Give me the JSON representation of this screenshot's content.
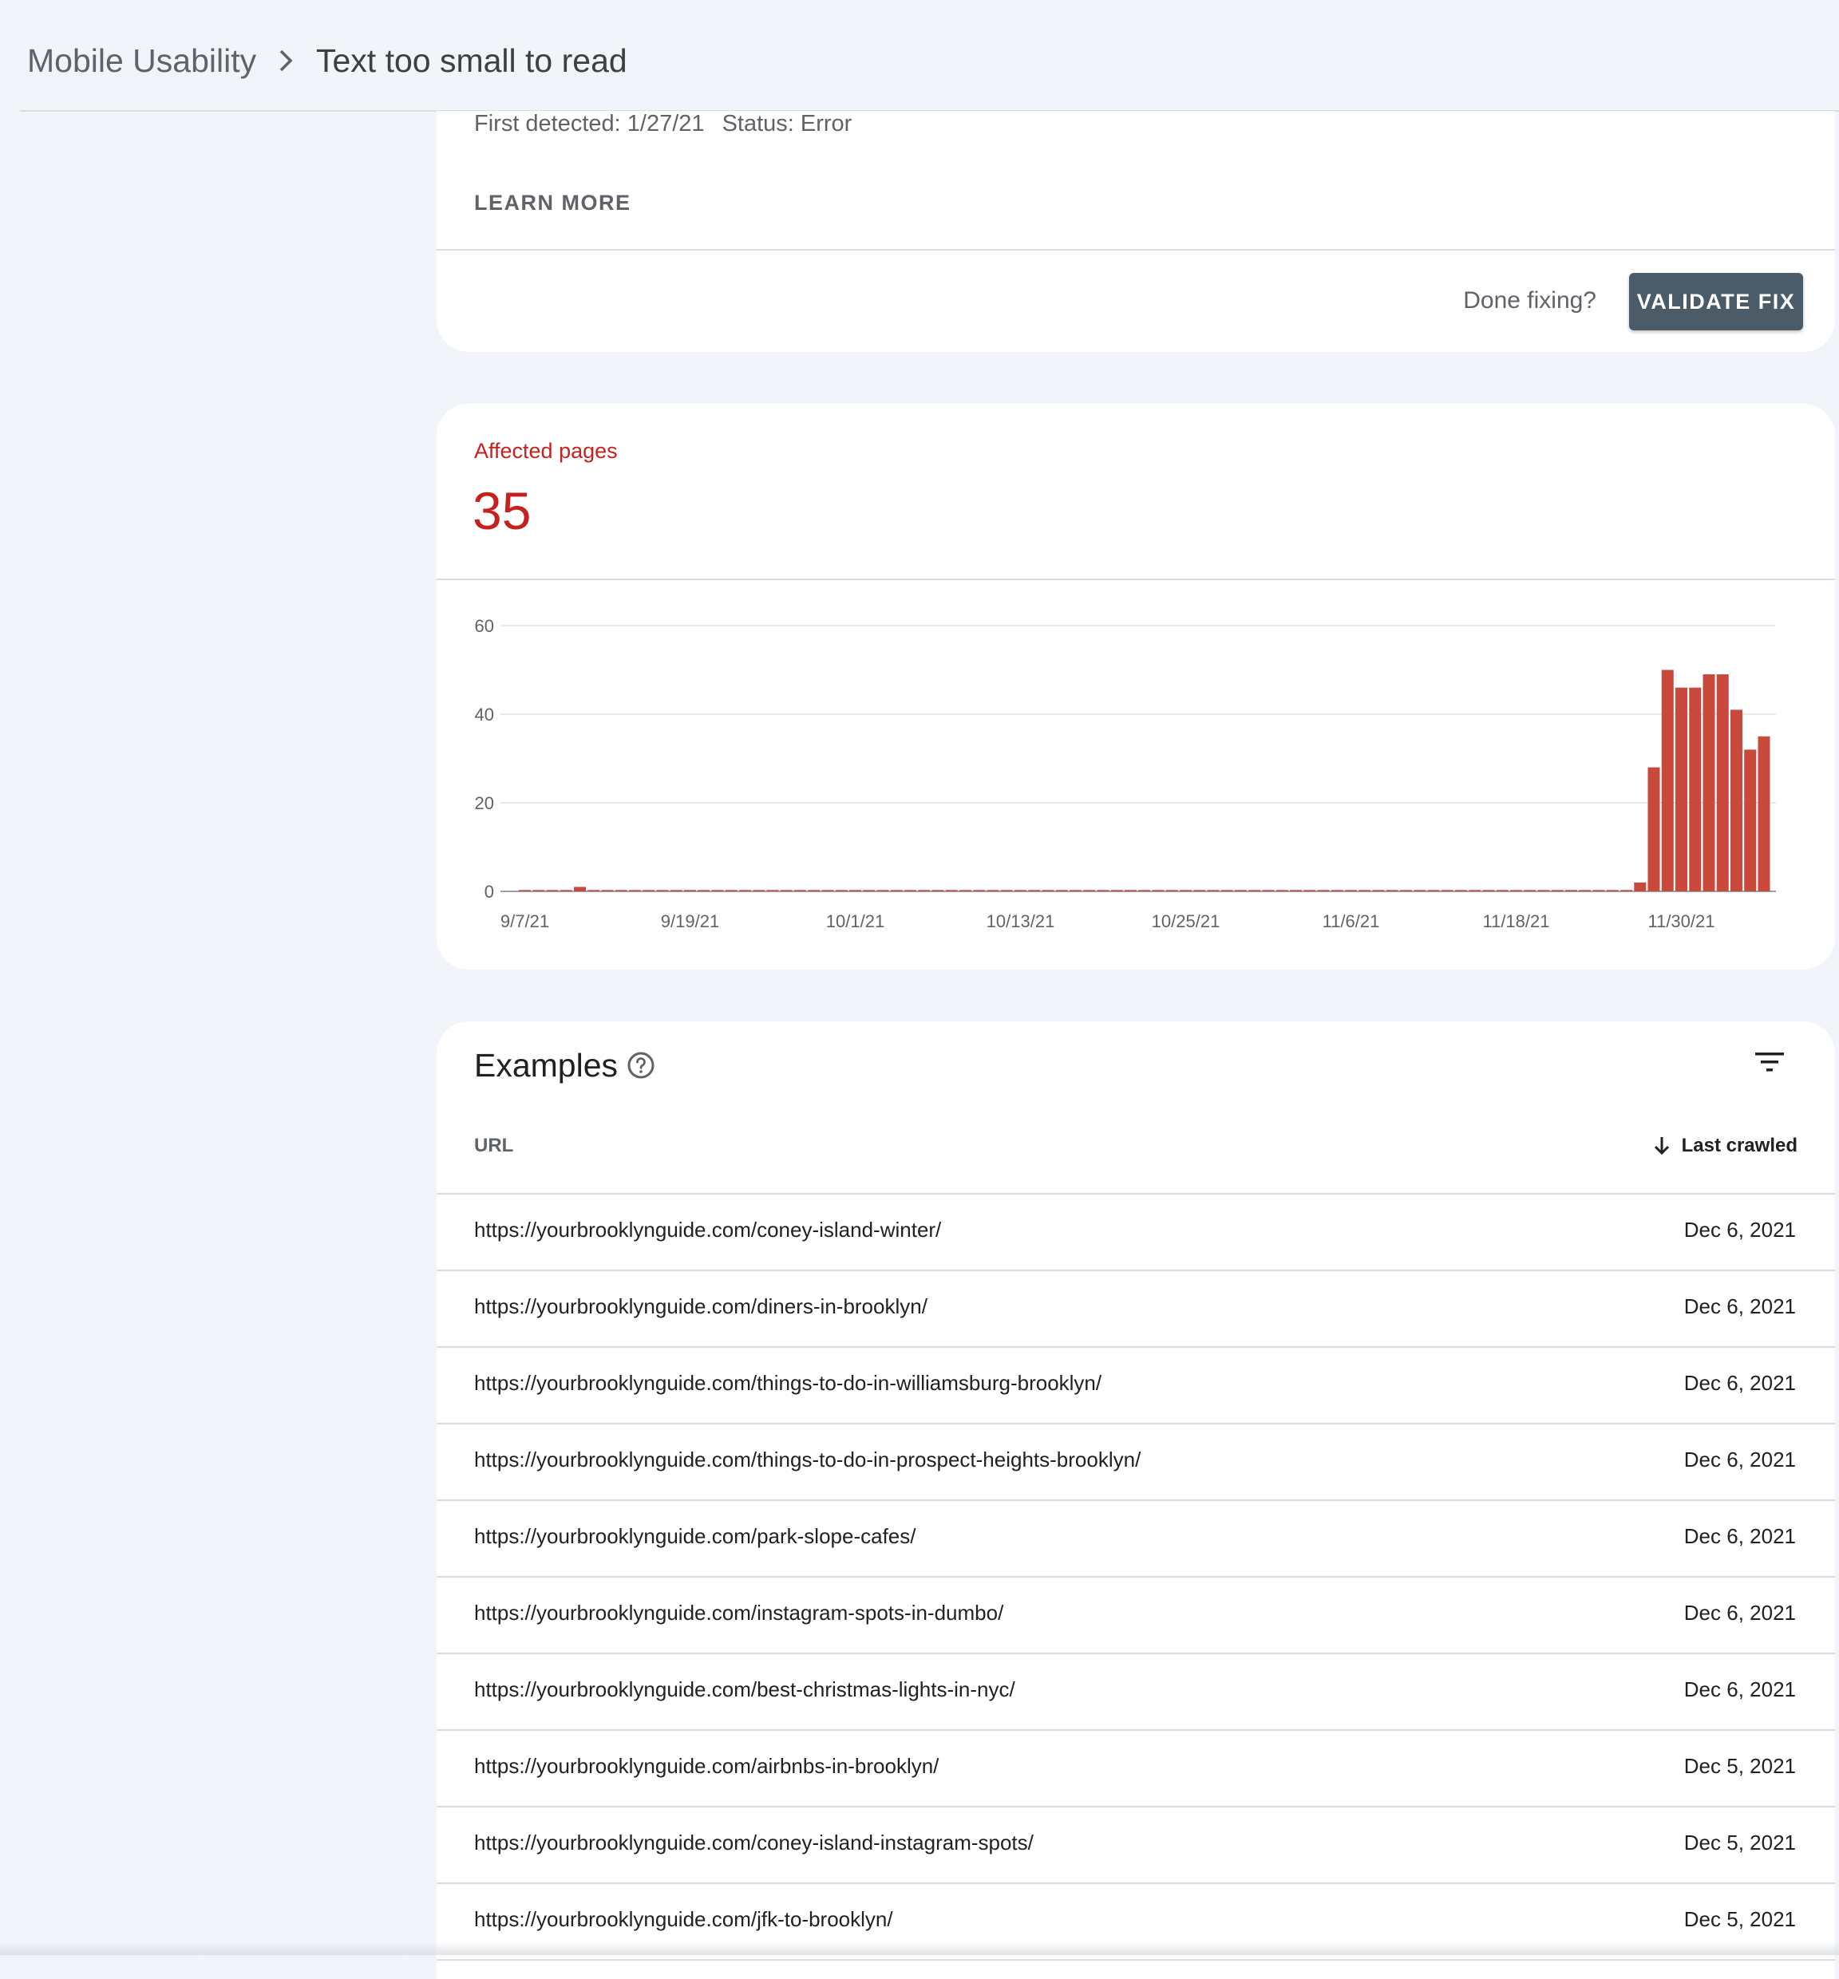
{
  "breadcrumb": {
    "root": "Mobile Usability",
    "current": "Text too small to read"
  },
  "details": {
    "first_detected": "First detected: 1/27/21",
    "status": "Status: Error",
    "learn_more": "LEARN MORE",
    "done_fixing": "Done fixing?",
    "validate_fix": "VALIDATE FIX"
  },
  "affected": {
    "label": "Affected pages",
    "value": "35"
  },
  "colors": {
    "accent": "#c5221f",
    "bar": "#c94a3c",
    "button": "#4b5b68"
  },
  "chart_data": {
    "type": "bar",
    "ylim": [
      0,
      60
    ],
    "yticks": [
      0,
      20,
      40,
      60
    ],
    "xtick_labels": [
      "9/7/21",
      "9/19/21",
      "10/1/21",
      "10/13/21",
      "10/25/21",
      "11/6/21",
      "11/18/21",
      "11/30/21"
    ],
    "categories": [
      "9/7/21",
      "9/8/21",
      "9/9/21",
      "9/10/21",
      "9/11/21",
      "9/12/21",
      "9/13/21",
      "9/14/21",
      "9/15/21",
      "9/16/21",
      "9/17/21",
      "9/18/21",
      "9/19/21",
      "9/20/21",
      "9/21/21",
      "9/22/21",
      "9/23/21",
      "9/24/21",
      "9/25/21",
      "9/26/21",
      "9/27/21",
      "9/28/21",
      "9/29/21",
      "9/30/21",
      "10/1/21",
      "10/2/21",
      "10/3/21",
      "10/4/21",
      "10/5/21",
      "10/6/21",
      "10/7/21",
      "10/8/21",
      "10/9/21",
      "10/10/21",
      "10/11/21",
      "10/12/21",
      "10/13/21",
      "10/14/21",
      "10/15/21",
      "10/16/21",
      "10/17/21",
      "10/18/21",
      "10/19/21",
      "10/20/21",
      "10/21/21",
      "10/22/21",
      "10/23/21",
      "10/24/21",
      "10/25/21",
      "10/26/21",
      "10/27/21",
      "10/28/21",
      "10/29/21",
      "10/30/21",
      "10/31/21",
      "11/1/21",
      "11/2/21",
      "11/3/21",
      "11/4/21",
      "11/5/21",
      "11/6/21",
      "11/7/21",
      "11/8/21",
      "11/9/21",
      "11/10/21",
      "11/11/21",
      "11/12/21",
      "11/13/21",
      "11/14/21",
      "11/15/21",
      "11/16/21",
      "11/17/21",
      "11/18/21",
      "11/19/21",
      "11/20/21",
      "11/21/21",
      "11/22/21",
      "11/23/21",
      "11/24/21",
      "11/25/21",
      "11/26/21",
      "11/27/21",
      "11/28/21",
      "11/29/21",
      "11/30/21",
      "12/1/21",
      "12/2/21",
      "12/3/21",
      "12/4/21",
      "12/5/21",
      "12/6/21"
    ],
    "values": [
      0.3,
      0.3,
      0.3,
      0.3,
      1,
      0.3,
      0.3,
      0.3,
      0.3,
      0.3,
      0.3,
      0.3,
      0.3,
      0.3,
      0.3,
      0.3,
      0.3,
      0.3,
      0.3,
      0.3,
      0.3,
      0.3,
      0.3,
      0.3,
      0.3,
      0.3,
      0.3,
      0.3,
      0.3,
      0.3,
      0.3,
      0.3,
      0.3,
      0.3,
      0.3,
      0.3,
      0.3,
      0.3,
      0.3,
      0.3,
      0.3,
      0.3,
      0.3,
      0.3,
      0.3,
      0.3,
      0.3,
      0.3,
      0.3,
      0.3,
      0.3,
      0.3,
      0.3,
      0.3,
      0.3,
      0.3,
      0.3,
      0.3,
      0.3,
      0.3,
      0.3,
      0.3,
      0.3,
      0.3,
      0.3,
      0.3,
      0.3,
      0.3,
      0.3,
      0.3,
      0.3,
      0.3,
      0.3,
      0.3,
      0.3,
      0.3,
      0.3,
      0.3,
      0.3,
      0.3,
      0.3,
      2,
      28,
      50,
      46,
      46,
      49,
      49,
      41,
      32,
      35
    ]
  },
  "examples": {
    "title": "Examples",
    "col_url": "URL",
    "col_last_crawled": "Last crawled",
    "rows": [
      {
        "url": "https://yourbrooklynguide.com/coney-island-winter/",
        "date": "Dec 6, 2021"
      },
      {
        "url": "https://yourbrooklynguide.com/diners-in-brooklyn/",
        "date": "Dec 6, 2021"
      },
      {
        "url": "https://yourbrooklynguide.com/things-to-do-in-williamsburg-brooklyn/",
        "date": "Dec 6, 2021"
      },
      {
        "url": "https://yourbrooklynguide.com/things-to-do-in-prospect-heights-brooklyn/",
        "date": "Dec 6, 2021"
      },
      {
        "url": "https://yourbrooklynguide.com/park-slope-cafes/",
        "date": "Dec 6, 2021"
      },
      {
        "url": "https://yourbrooklynguide.com/instagram-spots-in-dumbo/",
        "date": "Dec 6, 2021"
      },
      {
        "url": "https://yourbrooklynguide.com/best-christmas-lights-in-nyc/",
        "date": "Dec 6, 2021"
      },
      {
        "url": "https://yourbrooklynguide.com/airbnbs-in-brooklyn/",
        "date": "Dec 5, 2021"
      },
      {
        "url": "https://yourbrooklynguide.com/coney-island-instagram-spots/",
        "date": "Dec 5, 2021"
      },
      {
        "url": "https://yourbrooklynguide.com/jfk-to-brooklyn/",
        "date": "Dec 5, 2021"
      }
    ]
  }
}
